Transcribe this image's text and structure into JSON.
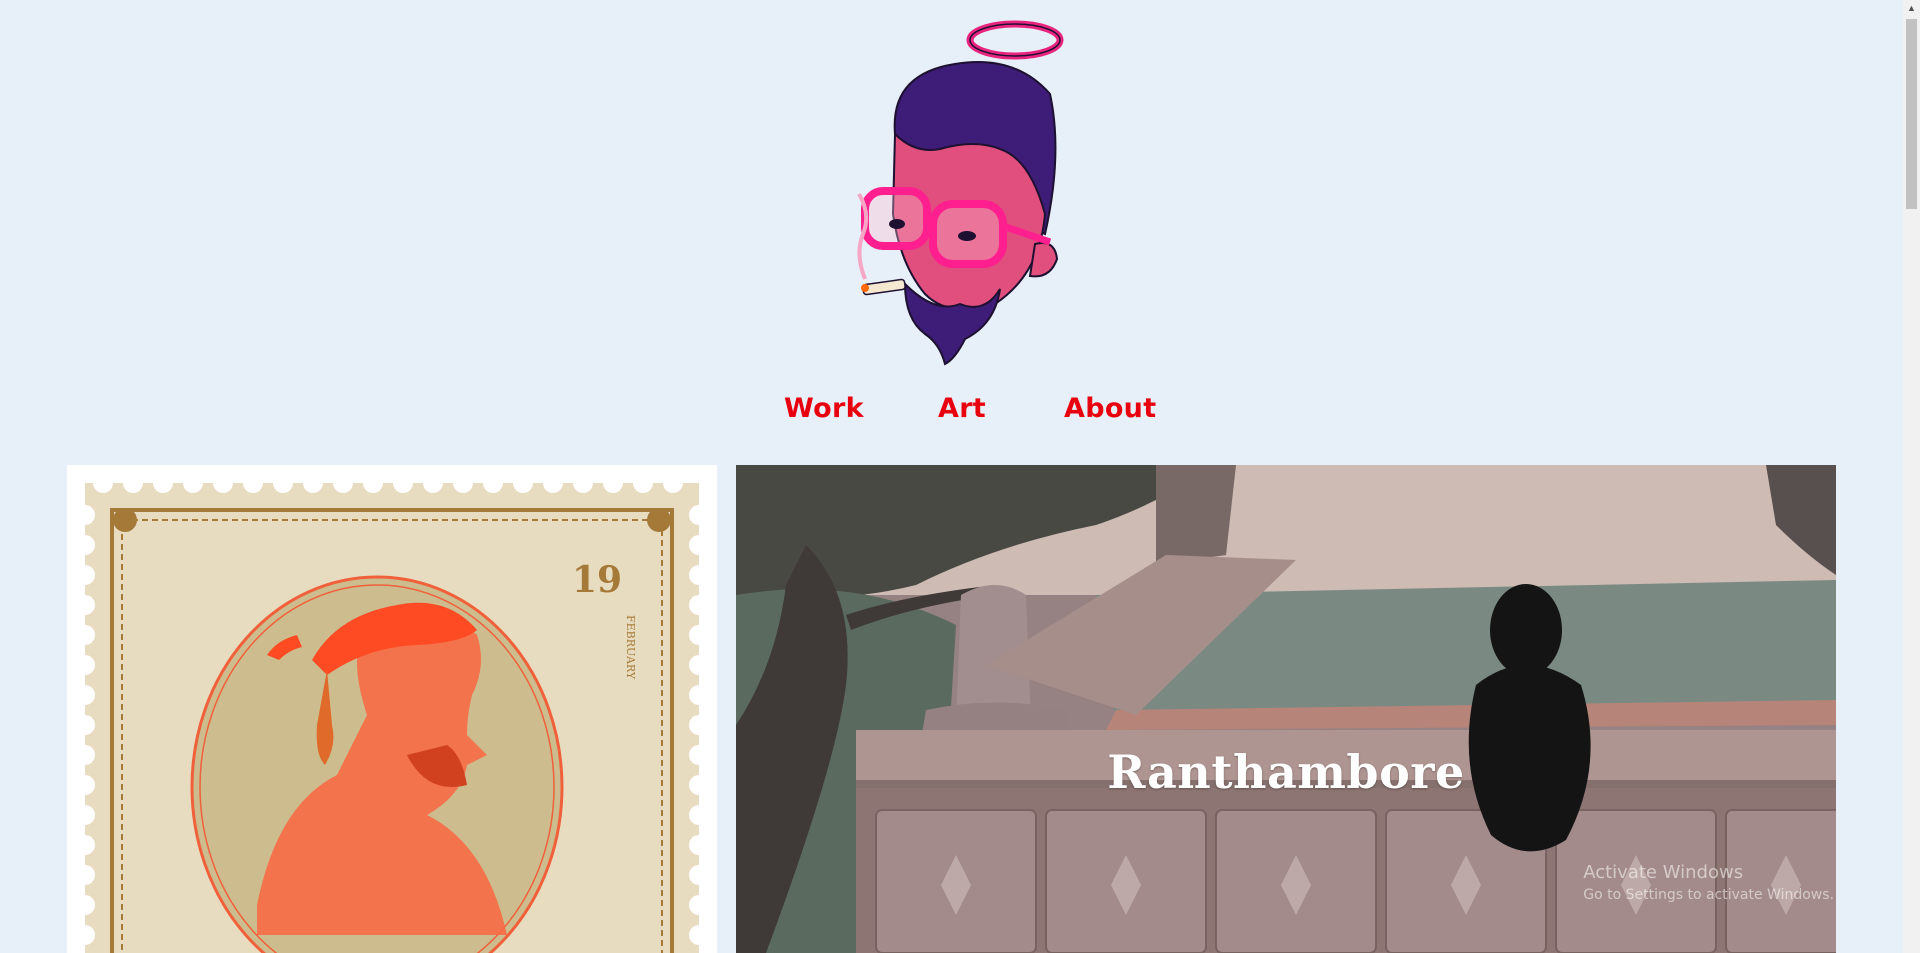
{
  "nav": {
    "items": [
      {
        "label": "Work"
      },
      {
        "label": "Art"
      },
      {
        "label": "About"
      }
    ]
  },
  "stamp": {
    "number": "19",
    "month": "FEBRUARY"
  },
  "featured": {
    "title": "Ranthambore"
  },
  "watermark": {
    "line1": "Activate Windows",
    "line2": "Go to Settings to activate Windows."
  },
  "colors": {
    "background": "#e7eff8",
    "nav_link": "#e8000f",
    "card_title": "#ffffff"
  }
}
